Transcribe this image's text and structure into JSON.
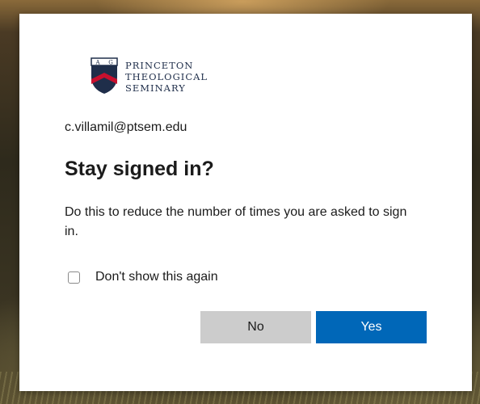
{
  "brand": {
    "crest_letters": "A  G",
    "name_lines": [
      "PRINCETON",
      "THEOLOGICAL",
      "SEMINARY"
    ],
    "colors": {
      "navy": "#1f2e4a",
      "red": "#c8102e"
    }
  },
  "account": {
    "email": "c.villamil@ptsem.edu"
  },
  "dialog": {
    "title": "Stay signed in?",
    "description": "Do this to reduce the number of times you are asked to sign in.",
    "checkbox_label": "Don't show this again",
    "checkbox_checked": false,
    "no_label": "No",
    "yes_label": "Yes"
  },
  "colors": {
    "primary": "#0067b8",
    "secondary": "#cccccc",
    "text": "#1b1b1b"
  }
}
